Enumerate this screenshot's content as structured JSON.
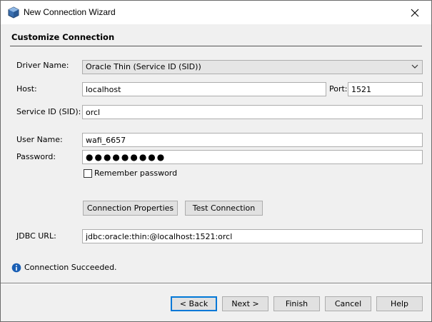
{
  "window": {
    "title": "New Connection Wizard"
  },
  "page": {
    "section_title": "Customize Connection"
  },
  "form": {
    "driver_label": "Driver Name:",
    "driver_value": "Oracle Thin (Service ID (SID))",
    "host_label": "Host:",
    "host_value": "localhost",
    "port_label": "Port:",
    "port_value": "1521",
    "sid_label": "Service ID (SID):",
    "sid_value": "orcl",
    "user_label": "User Name:",
    "user_value": "wafi_6657",
    "password_label": "Password:",
    "password_value": "●●●●●●●●●",
    "remember_label": "Remember password",
    "remember_checked": false,
    "jdbc_label": "JDBC URL:",
    "jdbc_value": "jdbc:oracle:thin:@localhost:1521:orcl"
  },
  "actions": {
    "connection_properties": "Connection Properties",
    "test_connection": "Test Connection"
  },
  "status": {
    "text": "Connection Succeeded."
  },
  "footer": {
    "back": "< Back",
    "next": "Next >",
    "finish": "Finish",
    "cancel": "Cancel",
    "help": "Help"
  },
  "colors": {
    "title_bg": "#ffffff",
    "dialog_bg": "#f0f0f0",
    "focus_blue": "#0078d7",
    "info_blue": "#1a5fb4"
  },
  "icons": {
    "app": "netbeans-cube-icon",
    "close": "close-icon",
    "dropdown": "chevron-down-icon",
    "status": "info-icon"
  }
}
